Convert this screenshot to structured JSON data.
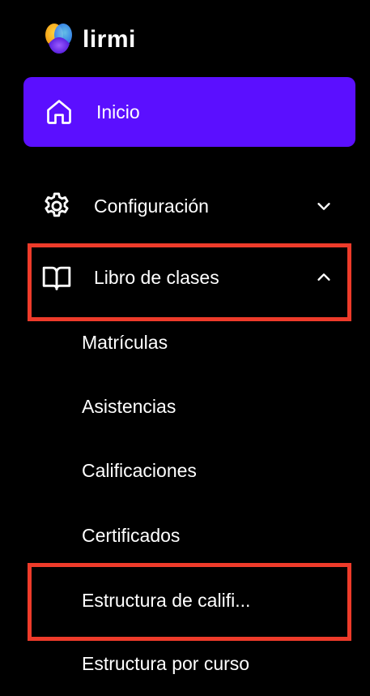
{
  "brand": {
    "name": "lirmi"
  },
  "nav": {
    "inicio": {
      "label": "Inicio",
      "icon": "home-icon",
      "active": true
    },
    "configuracion": {
      "label": "Configuración",
      "icon": "gear-icon",
      "chevron": "chevron-down-icon"
    },
    "libro": {
      "label": "Libro de clases",
      "icon": "book-icon",
      "chevron": "chevron-up-icon",
      "expanded": true
    },
    "libro_items": [
      "Matrículas",
      "Asistencias",
      "Calificaciones",
      "Certificados",
      "Estructura de califi...",
      "Estructura por curso"
    ]
  },
  "colors": {
    "background": "#000000",
    "active_item": "#5b0fff",
    "highlight": "#ee3b2a",
    "text": "#ffffff"
  }
}
